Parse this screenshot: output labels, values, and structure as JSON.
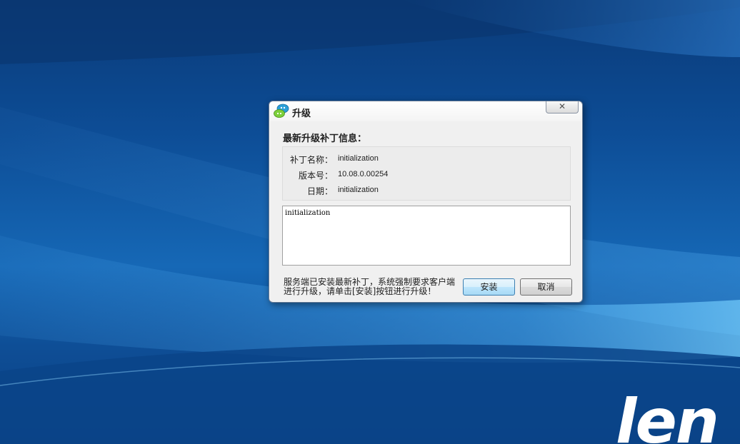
{
  "desktop": {
    "brand_text": "len"
  },
  "dialog": {
    "title": "升级",
    "close_glyph": "✕",
    "section_title": "最新升级补丁信息：",
    "info": {
      "patch_name_label": "补丁名称：",
      "patch_name_value": "initialization",
      "version_label": "版本号：",
      "version_value": "10.08.0.00254",
      "date_label": "日期：",
      "date_value": "initialization"
    },
    "notes_text": "initialization",
    "footer_message": "服务端已安装最新补丁，系统强制要求客户端进行升级，请单击[安装]按钮进行升级！",
    "install_label": "安装",
    "cancel_label": "取消"
  },
  "colors": {
    "desktop_blue": "#0d4d96",
    "dialog_bg": "#f0f0f0",
    "primary_button": "#bee6fd"
  },
  "icons": {
    "app_icon": "chat-bubbles-icon",
    "close_icon": "close-icon"
  }
}
